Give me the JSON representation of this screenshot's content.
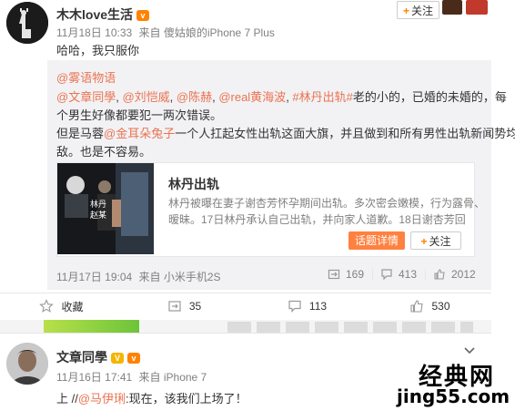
{
  "post1": {
    "username": "木木love生活",
    "badge": "v",
    "follow_label": "关注",
    "date": "11月18日 10:33",
    "source": "来自 傻姑娘的iPhone 7 Plus",
    "text": "哈哈，我只服你",
    "repost": {
      "author": "@雾语物语",
      "line1_mentions": [
        "@文章同學",
        "@刘恺威",
        "@陈赫",
        "@real黄海波",
        "#林丹出轨#"
      ],
      "line1_tail": "老的小的，已婚的未婚的，每",
      "line2": "个男生好像都要犯一两次错误。",
      "line3_pre": "但是马蓉",
      "line3_mention": "@金耳朵兔子",
      "line3_post": "一个人扛起女性出轨这面大旗，并且做到和所有男性出轨新闻势均力",
      "line4": "敌。也是不容易。",
      "card": {
        "image_caption_1": "林丹",
        "image_caption_2": "赵某",
        "title": "林丹出轨",
        "desc_line1": "林丹被曝在妻子谢杏芳怀孕期间出轨。多次密会嫩模，行为露骨、",
        "desc_line2": "暧昧。17日林丹承认自己出轨，并向家人道歉。18日谢杏芳回",
        "topic_button": "话题详情",
        "follow_button": "关注"
      },
      "date": "11月17日 19:04",
      "source": "来自 小米手机2S",
      "repost_count": "169",
      "comment_count": "413",
      "like_count": "2012"
    },
    "actions": {
      "favorite": "收藏",
      "repost": "35",
      "comment": "113",
      "like": "530"
    }
  },
  "post2": {
    "username": "文章同學",
    "badge": "V",
    "date": "11月16日 17:41",
    "source": "来自 iPhone 7",
    "text_pre": "上 //",
    "mention": "@马伊琍",
    "text_post": ":现在，该我们上场了！"
  },
  "watermark": {
    "line1": "经典网",
    "line2": "jing55.com"
  },
  "colors": {
    "accent_link": "#eb7350",
    "topic_orange": "#ff8140",
    "gray_text": "#808080",
    "repost_bg": "#f2f2f5"
  }
}
